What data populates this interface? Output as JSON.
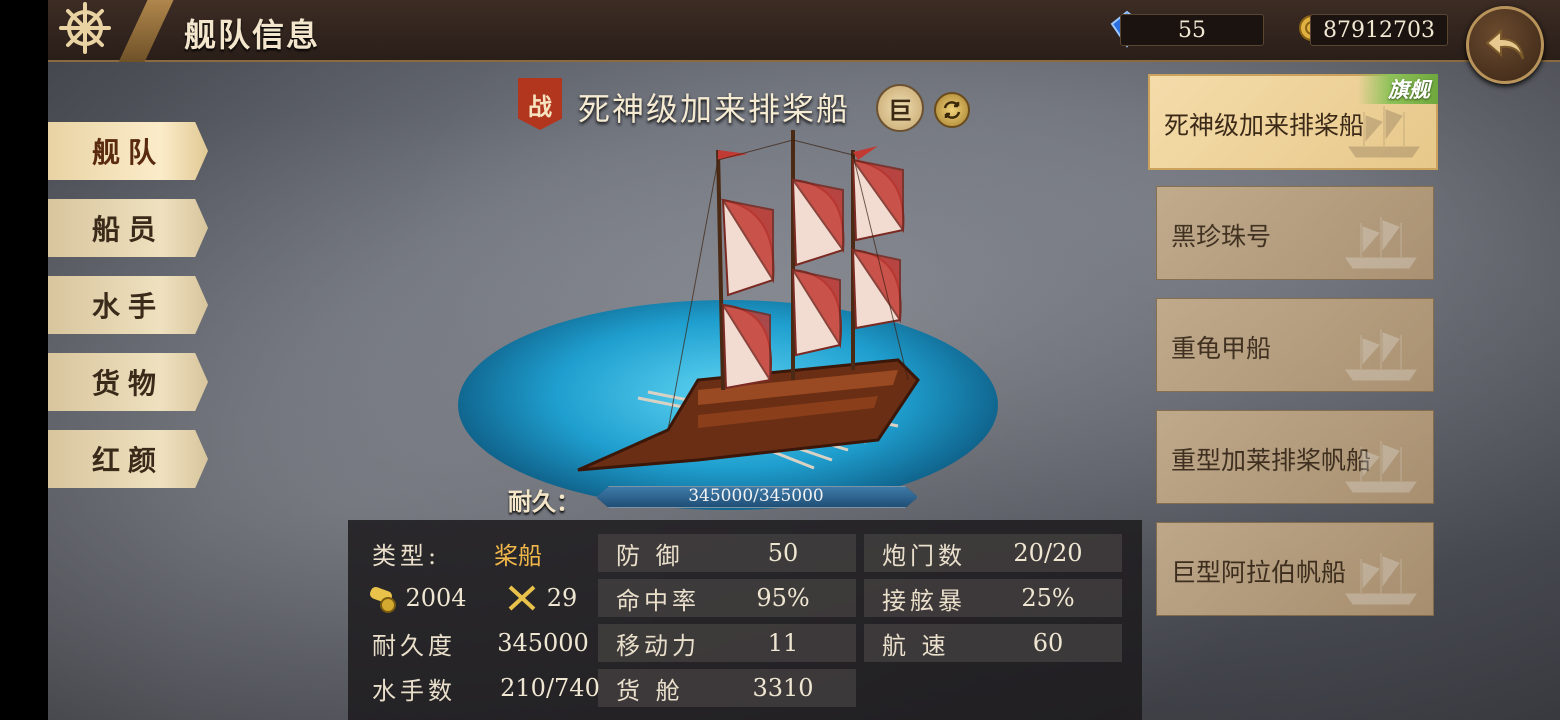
{
  "header": {
    "title": "舰队信息",
    "gems": "55",
    "gold": "87912703"
  },
  "nav": {
    "items": [
      {
        "label": "舰队",
        "active": true
      },
      {
        "label": "船员",
        "active": false
      },
      {
        "label": "水手",
        "active": false
      },
      {
        "label": "货物",
        "active": false
      },
      {
        "label": "红颜",
        "active": false
      }
    ]
  },
  "ship": {
    "badge": "战",
    "name": "死神级加来排桨船",
    "size_badge": "巨",
    "durability_label": "耐久：",
    "durability_text": "345000/345000",
    "durability_fraction": 1.0
  },
  "stats": {
    "type_label": "类型:",
    "type_value": "桨船",
    "cannon_value": "2004",
    "melee_value": "29",
    "durability_label": "耐久度",
    "durability_value": "345000",
    "sailors_label": "水手数",
    "sailors_value": "210/740",
    "defense_label": "防 御",
    "defense_value": "50",
    "hit_label": "命中率",
    "hit_value": "95%",
    "mobility_label": "移动力",
    "mobility_value": "11",
    "cargo_label": "货 舱",
    "cargo_value": "3310",
    "gunports_label": "炮门数",
    "gunports_value": "20/20",
    "boarding_label": "接舷暴",
    "boarding_value": "25%",
    "speed_label": "航 速",
    "speed_value": "60"
  },
  "fleet": {
    "flagship_tag": "旗舰",
    "ships": [
      {
        "name": "死神级加来排桨船",
        "selected": true
      },
      {
        "name": "黑珍珠号",
        "selected": false
      },
      {
        "name": "重龟甲船",
        "selected": false
      },
      {
        "name": "重型加莱排桨帆船",
        "selected": false
      },
      {
        "name": "巨型阿拉伯帆船",
        "selected": false
      }
    ]
  },
  "colors": {
    "accent": "#f0b64a",
    "badge_red": "#b2351e",
    "sail_red": "#c23a34",
    "water": "#1f9fcf"
  }
}
